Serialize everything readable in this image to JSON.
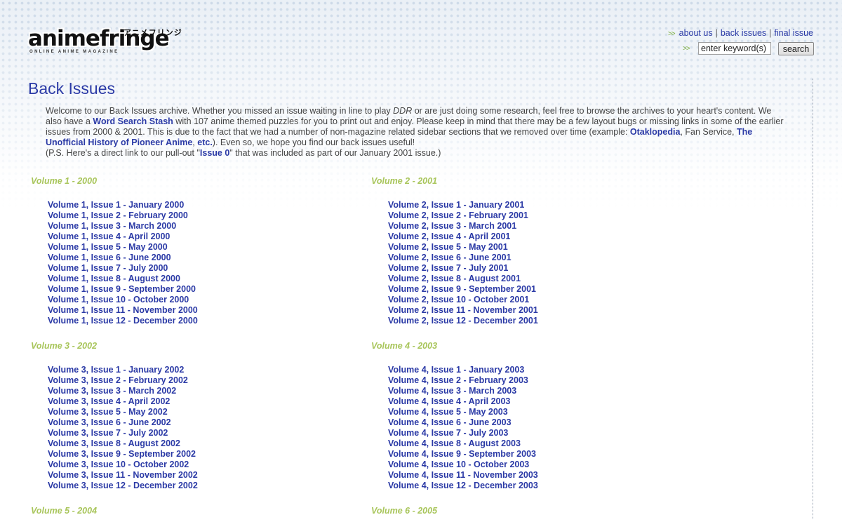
{
  "logo": {
    "text": "animefringe",
    "kana": "アニメフリンジ",
    "tagline": "ONLINE ANIME MAGAZINE"
  },
  "nav": {
    "arrow": ">>",
    "separator": "|",
    "about": "about us",
    "back_issues": "back issues",
    "final_issue": "final issue"
  },
  "search": {
    "arrow": ">>",
    "value": "enter keyword(s)",
    "button": "search"
  },
  "page_title": "Back Issues",
  "intro": {
    "p1": "Welcome to our Back Issues archive. Whether you missed an issue waiting in line to play ",
    "ddr": "DDR",
    "p2": " or are just doing some research, feel free to browse the archives to your heart's content. We also have a ",
    "word_search": "Word Search Stash",
    "p3": " with 107 anime themed puzzles for you to print out and enjoy. Please keep in mind that there may be a few layout bugs or missing links in some of the earlier issues from 2000 & 2001. This is due to the fact that we had a number of non-magazine related sidebar sections that we removed over time (example: ",
    "otaklopedia": "Otaklopedia",
    "p4": ", Fan Service, ",
    "pioneer": "The Unofficial History of Pioneer Anime",
    "p5": ", ",
    "etc": "etc.",
    "p6": "). Even so, we hope you find our back issues useful!",
    "ps1": "(P.S. Here's a direct link to our pull-out \"",
    "issue0": "Issue 0",
    "ps2": "\" that was included as part of our January 2001 issue.)"
  },
  "volumes": [
    {
      "heading": "Volume 1 - 2000",
      "issues": [
        "Volume 1, Issue 1 - January 2000",
        "Volume 1, Issue 2 - February 2000",
        "Volume 1, Issue 3 - March 2000",
        "Volume 1, Issue 4 - April 2000",
        "Volume 1, Issue 5 - May 2000",
        "Volume 1, Issue 6 - June 2000",
        "Volume 1, Issue 7 - July 2000",
        "Volume 1, Issue 8 - August 2000",
        "Volume 1, Issue 9 - September 2000",
        "Volume 1, Issue 10 - October 2000",
        "Volume 1, Issue 11 - November 2000",
        "Volume 1, Issue 12 - December 2000"
      ]
    },
    {
      "heading": "Volume 2 - 2001",
      "issues": [
        "Volume 2, Issue 1 - January 2001",
        "Volume 2, Issue 2 - February 2001",
        "Volume 2, Issue 3 - March 2001",
        "Volume 2, Issue 4 - April 2001",
        "Volume 2, Issue 5 - May 2001",
        "Volume 2, Issue 6 - June 2001",
        "Volume 2, Issue 7 - July 2001",
        "Volume 2, Issue 8 - August 2001",
        "Volume 2, Issue 9 - September 2001",
        "Volume 2, Issue 10 - October 2001",
        "Volume 2, Issue 11 - November 2001",
        "Volume 2, Issue 12 - December 2001"
      ]
    },
    {
      "heading": "Volume 3 - 2002",
      "issues": [
        "Volume 3, Issue 1 - January 2002",
        "Volume 3, Issue 2 - February 2002",
        "Volume 3, Issue 3 - March 2002",
        "Volume 3, Issue 4 - April 2002",
        "Volume 3, Issue 5 - May 2002",
        "Volume 3, Issue 6 - June 2002",
        "Volume 3, Issue 7 - July 2002",
        "Volume 3, Issue 8 - August 2002",
        "Volume 3, Issue 9 - September 2002",
        "Volume 3, Issue 10 - October 2002",
        "Volume 3, Issue 11 - November 2002",
        "Volume 3, Issue 12 - December 2002"
      ]
    },
    {
      "heading": "Volume 4 - 2003",
      "issues": [
        "Volume 4, Issue 1 - January 2003",
        "Volume 4, Issue 2 - February 2003",
        "Volume 4, Issue 3 - March 2003",
        "Volume 4, Issue 4 - April 2003",
        "Volume 4, Issue 5 - May 2003",
        "Volume 4, Issue 6 - June 2003",
        "Volume 4, Issue 7 - July 2003",
        "Volume 4, Issue 8 - August 2003",
        "Volume 4, Issue 9 - September 2003",
        "Volume 4, Issue 10 - October 2003",
        "Volume 4, Issue 11 - November 2003",
        "Volume 4, Issue 12 - December 2003"
      ]
    },
    {
      "heading": "Volume 5 - 2004",
      "issues": []
    },
    {
      "heading": "Volume 6 - 2005",
      "issues": []
    }
  ]
}
